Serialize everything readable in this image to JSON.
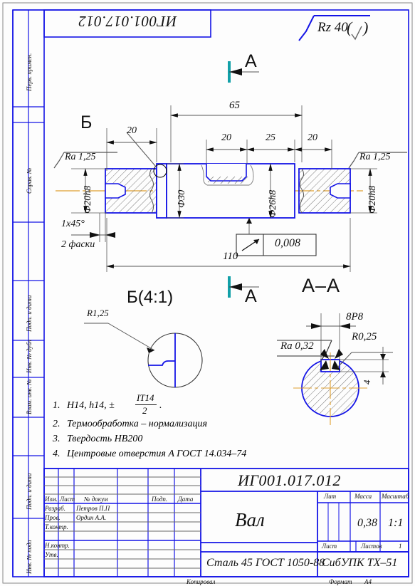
{
  "sheet": {
    "format_label": "Формат",
    "format_value": "A4",
    "copied_label": "Копировал",
    "designation_top": "ИГ001.017.012"
  },
  "surface_finish": {
    "general": "Rz 40",
    "general_paren_open": "(",
    "general_paren_close": ")",
    "left_shaft": "Ra 1,25",
    "right_shaft": "Ra 1,25",
    "keyway": "Ra 0,32"
  },
  "margin_labels": [
    "Перв. примен.",
    "Справ. №",
    "Подп. и дата",
    "Инв. № дубл",
    "Взам. инв. №",
    "Подп. и дата",
    "Инв. № подл"
  ],
  "views": {
    "detail_label": "Б",
    "detail_title": "Б(4:1)",
    "detail_radius": "R1,25",
    "section_marker": "A",
    "section_title": "A–A",
    "section_keyway_width": "8P8",
    "section_fillet": "R0,25",
    "section_depth": "4"
  },
  "dimensions": {
    "len_left_journal": "20",
    "len_65": "65",
    "len_20b": "20",
    "len_25": "25",
    "len_20c": "20",
    "len_110": "110",
    "dia_30": "Ф30",
    "dia_26h8": "Ф26h8",
    "dia_20h8_left": "Ф20h8",
    "dia_20h8_right": "Ф20h8",
    "chamfer": "1x45°",
    "chamfer_note": "2 фаски",
    "tolerance_symbol": "↗",
    "tolerance_value": "0,008"
  },
  "tech_requirements": [
    {
      "num": "1.",
      "text": "H14, h14, ±",
      "frac_top": "IT14",
      "frac_bottom": "2",
      "tail": "."
    },
    {
      "num": "2.",
      "text": "Термообработка – нормализация"
    },
    {
      "num": "3.",
      "text": "Твердость HB200"
    },
    {
      "num": "4.",
      "text": "Центровые отверстия A ГОСТ 14.034–74"
    }
  ],
  "title_block": {
    "designation": "ИГ001.017.012",
    "part_name": "Вал",
    "material": "Сталь 45  ГОСТ 1050-88",
    "organization": "СибУПК ТХ–51",
    "columns": {
      "izm": "Изм.",
      "list": "Лист",
      "doc": "№ докум",
      "podp": "Подп.",
      "data": "Дата"
    },
    "roles": [
      {
        "role": "Разраб.",
        "name": "Петров П.П"
      },
      {
        "role": "Пров.",
        "name": "Ордин А.А."
      },
      {
        "role": "Т.контр.",
        "name": ""
      },
      {
        "role": "",
        "name": ""
      },
      {
        "role": "Н.контр.",
        "name": ""
      },
      {
        "role": "Утв.",
        "name": ""
      }
    ],
    "lit_label": "Лит",
    "mass_label": "Масса",
    "scale_label": "Масштаб",
    "mass_value": "0,38",
    "scale_value": "1:1",
    "sheet_label": "Лист",
    "sheets_label": "Листов",
    "sheets_value": "1"
  },
  "colors": {
    "frame": "#1414e6",
    "part_outline": "#1414e6",
    "axis": "#e0a030",
    "dim_line": "#555555",
    "section_mark": "#12a0a8",
    "text": "#111111"
  }
}
